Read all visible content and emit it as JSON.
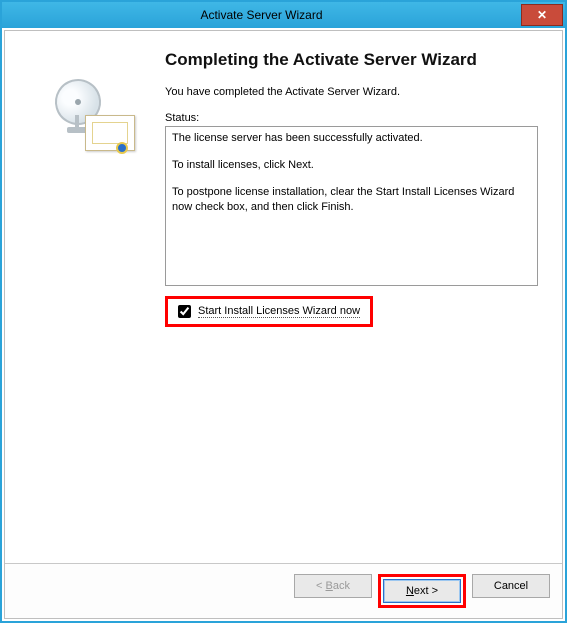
{
  "window": {
    "title": "Activate Server Wizard",
    "close_label": "✕"
  },
  "main": {
    "heading": "Completing the Activate Server Wizard",
    "intro": "You have completed the Activate Server Wizard.",
    "status_label": "Status:",
    "status_lines": {
      "l1": "The license server has been successfully activated.",
      "l2": "To install licenses, click Next.",
      "l3": "To postpone license installation, clear the Start Install Licenses Wizard now check box, and then click Finish."
    },
    "checkbox": {
      "checked": true,
      "label": "Start Install Licenses Wizard now"
    }
  },
  "footer": {
    "back": "< Back",
    "next": "Next >",
    "cancel": "Cancel"
  },
  "icons": {
    "wizard_graphic": "satellite-cert-icon",
    "close": "close-icon"
  },
  "highlights": {
    "checkbox": true,
    "next_button": true
  }
}
